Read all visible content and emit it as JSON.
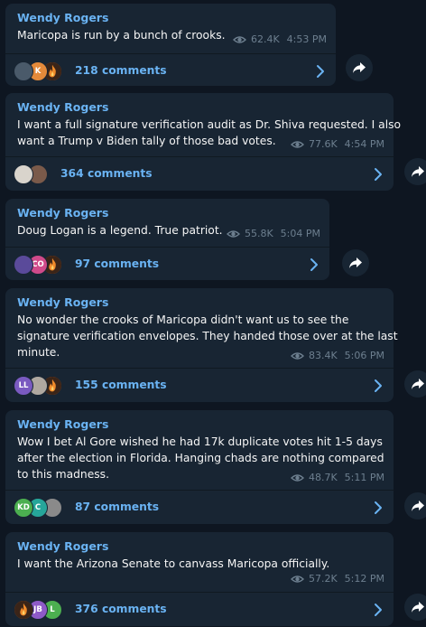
{
  "messages": [
    {
      "sender": "Wendy Rogers",
      "lines": [
        "Maricopa is run by a bunch of crooks."
      ],
      "views": "62.4K",
      "time": "4:53 PM",
      "comments": "218 comments",
      "avatars": [
        {
          "label": "",
          "color": "#4a5a6a",
          "icon": "photo-avatar"
        },
        {
          "label": "K",
          "color": "#e58a3a",
          "icon": "initial-avatar"
        },
        {
          "label": "",
          "color": "#c05820",
          "icon": "fire-avatar"
        }
      ]
    },
    {
      "sender": "Wendy Rogers",
      "lines": [
        "I want a full signature verification audit as Dr. Shiva requested. I also",
        "want a Trump v Biden tally of those bad votes."
      ],
      "views": "77.6K",
      "time": "4:54 PM",
      "comments": "364 comments",
      "avatars": [
        {
          "label": "",
          "color": "#d9d4cc",
          "icon": "photo-avatar"
        },
        {
          "label": "",
          "color": "#7a5a4a",
          "icon": "photo-avatar"
        }
      ]
    },
    {
      "sender": "Wendy Rogers",
      "lines": [
        "Doug Logan is a legend. True patriot."
      ],
      "views": "55.8K",
      "time": "5:04 PM",
      "comments": "97 comments",
      "avatars": [
        {
          "label": "",
          "color": "#5a4a9a",
          "icon": "photo-avatar"
        },
        {
          "label": "CO",
          "color": "#d04a8a",
          "icon": "initial-avatar"
        },
        {
          "label": "",
          "color": "#c05820",
          "icon": "fire-avatar"
        }
      ]
    },
    {
      "sender": "Wendy Rogers",
      "lines": [
        "No wonder the crooks of Maricopa didn't want us to see the",
        "signature verification envelopes. They handed those over at the last",
        "minute."
      ],
      "views": "83.4K",
      "time": "5:06 PM",
      "comments": "155 comments",
      "avatars": [
        {
          "label": "LL",
          "color": "#7a5ac0",
          "icon": "initial-avatar"
        },
        {
          "label": "",
          "color": "#b0a8a0",
          "icon": "photo-avatar"
        },
        {
          "label": "",
          "color": "#c05820",
          "icon": "fire-avatar"
        }
      ]
    },
    {
      "sender": "Wendy Rogers",
      "lines": [
        "Wow I bet Al Gore wished he had 17k duplicate votes hit 1-5 days",
        "after the election in Florida. Hanging chads are nothing compared",
        "to this madness."
      ],
      "views": "48.7K",
      "time": "5:11 PM",
      "comments": "87 comments",
      "avatars": [
        {
          "label": "KD",
          "color": "#4caf50",
          "icon": "initial-avatar"
        },
        {
          "label": "C",
          "color": "#26a69a",
          "icon": "initial-avatar"
        },
        {
          "label": "",
          "color": "#8a8a8a",
          "icon": "photo-avatar"
        }
      ]
    },
    {
      "sender": "Wendy Rogers",
      "lines": [
        "I want the Arizona Senate to canvass Maricopa officially."
      ],
      "views": "57.2K",
      "time": "5:12 PM",
      "comments": "376 comments",
      "avatars": [
        {
          "label": "",
          "color": "#c05820",
          "icon": "fire-avatar"
        },
        {
          "label": "JB",
          "color": "#8e5ac8",
          "icon": "initial-avatar"
        },
        {
          "label": "L",
          "color": "#4caf50",
          "icon": "initial-avatar"
        }
      ]
    }
  ],
  "colors": {
    "background": "#0e1621",
    "bubble": "#182533",
    "accent": "#6ab3f3",
    "meta": "#6d7f8f"
  }
}
